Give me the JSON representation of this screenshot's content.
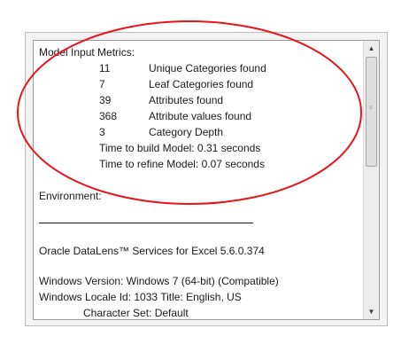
{
  "metrics": {
    "header": "Model Input Metrics:",
    "rows": [
      {
        "count": "11",
        "label": "Unique Categories found"
      },
      {
        "count": "7",
        "label": "Leaf Categories found"
      },
      {
        "count": "39",
        "label": "Attributes found"
      },
      {
        "count": "368",
        "label": "Attribute values found"
      },
      {
        "count": "3",
        "label": "Category Depth"
      }
    ],
    "build_time": "Time to build Model: 0.31 seconds",
    "refine_time": "Time to refine Model: 0.07 seconds"
  },
  "environment": {
    "header": "Environment:",
    "service": "Oracle DataLens™ Services for Excel  5.6.0.374",
    "windows_version": "Windows Version: Windows 7  (64-bit)  (Compatible)",
    "locale": "Windows Locale Id: 1033 Title: English, US",
    "charset": "Character Set: Default"
  },
  "colors": {
    "annotation": "#e8141b"
  },
  "scroll": {
    "position": 0.0
  }
}
